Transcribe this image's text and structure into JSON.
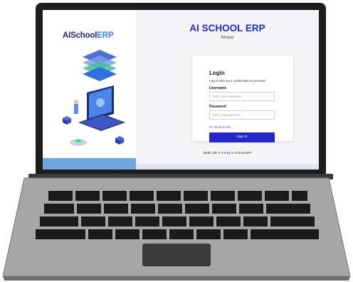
{
  "brand": {
    "logo_ai": "AI",
    "logo_school": "School",
    "logo_erp": "ERP"
  },
  "header": {
    "school_name": "AI SCHOOL ERP",
    "city": "Bhopal"
  },
  "login": {
    "title": "Login",
    "subtitle": "Log in with your credentials to proceed.",
    "username_label": "Username",
    "username_placeholder": "Enter your Username",
    "password_label": "Password",
    "password_placeholder": "Enter your password",
    "ip_text": "IP: 45.43.41.92",
    "signin_label": "Sign In"
  },
  "footer": {
    "made_with": "Made with",
    "and": "&",
    "by": "by AI School ERP"
  },
  "colors": {
    "brand_blue": "#1f2ed8",
    "button_blue": "#2426c8",
    "heart_red": "#e53935",
    "screen_bg": "#f4f4f6"
  },
  "icons": [
    "heart-icon",
    "book-icon",
    "isometric-laptop-illustration"
  ]
}
